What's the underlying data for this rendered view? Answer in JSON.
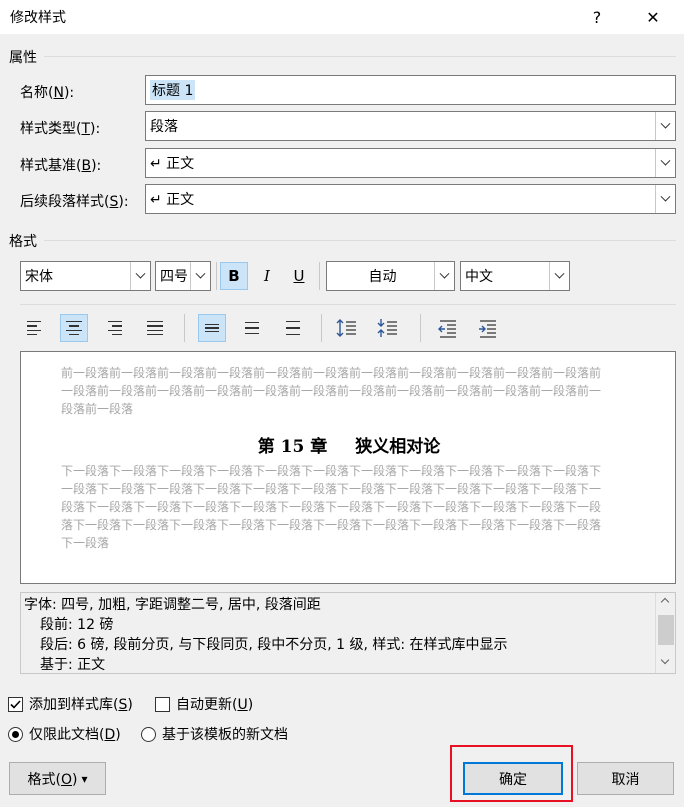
{
  "window": {
    "title": "修改样式",
    "help_glyph": "?",
    "close_glyph": "✕"
  },
  "properties": {
    "section_label": "属性",
    "name_label": "名称(",
    "name_key": "N",
    "name_label_end": "):",
    "name_value": "标题 1",
    "type_label": "样式类型(",
    "type_key": "T",
    "type_label_end": "):",
    "type_value": "段落",
    "base_label": "样式基准(",
    "base_key": "B",
    "base_label_end": "):",
    "base_value": "↵ 正文",
    "next_label": "后续段落样式(",
    "next_key": "S",
    "next_label_end": "):",
    "next_value": "↵ 正文"
  },
  "format": {
    "section_label": "格式",
    "font": "宋体",
    "size": "四号",
    "bold": "B",
    "italic": "I",
    "underline": "U",
    "color": "自动",
    "script": "中文"
  },
  "preview": {
    "prev_paragraph": "前一段落前一段落前一段落前一段落前一段落前一段落前一段落前一段落前一段落前一段落前一段落前一段落前一段落前一段落前一段落前一段落前一段落前一段落前一段落前一段落前一段落前一段落前一段落前一段落",
    "heading_number": "第 15 章",
    "heading_text": "狭义相对论",
    "next_paragraph": "下一段落下一段落下一段落下一段落下一段落下一段落下一段落下一段落下一段落下一段落下一段落下一段落下一段落下一段落下一段落下一段落下一段落下一段落下一段落下一段落下一段落下一段落下一段落下一段落下一段落下一段落下一段落下一段落下一段落下一段落下一段落下一段落下一段落下一段落下一段落下一段落下一段落下一段落下一段落下一段落下一段落下一段落下一段落下一段落下一段落下一段落"
  },
  "description": {
    "lines": [
      "字体: 四号, 加粗, 字距调整二号, 居中, 段落间距",
      "段前: 12 磅",
      "段后: 6 磅, 段前分页, 与下段同页, 段中不分页, 1 级, 样式: 在样式库中显示",
      "基于: 正文"
    ]
  },
  "options": {
    "add_to_gallery": "添加到样式库(",
    "add_to_gallery_key": "S",
    "add_to_gallery_end": ")",
    "auto_update": "自动更新(",
    "auto_update_key": "U",
    "auto_update_end": ")",
    "only_this_doc": "仅限此文档(",
    "only_this_doc_key": "D",
    "only_this_doc_end": ")",
    "template_docs": "基于该模板的新文档"
  },
  "buttons": {
    "format": "格式(",
    "format_key": "O",
    "format_end": ")",
    "format_arrow": "▾",
    "ok": "确定",
    "cancel": "取消"
  },
  "colors": {
    "accent": "#0078d7",
    "highlight": "#e81123",
    "selection": "#cce4f7"
  }
}
